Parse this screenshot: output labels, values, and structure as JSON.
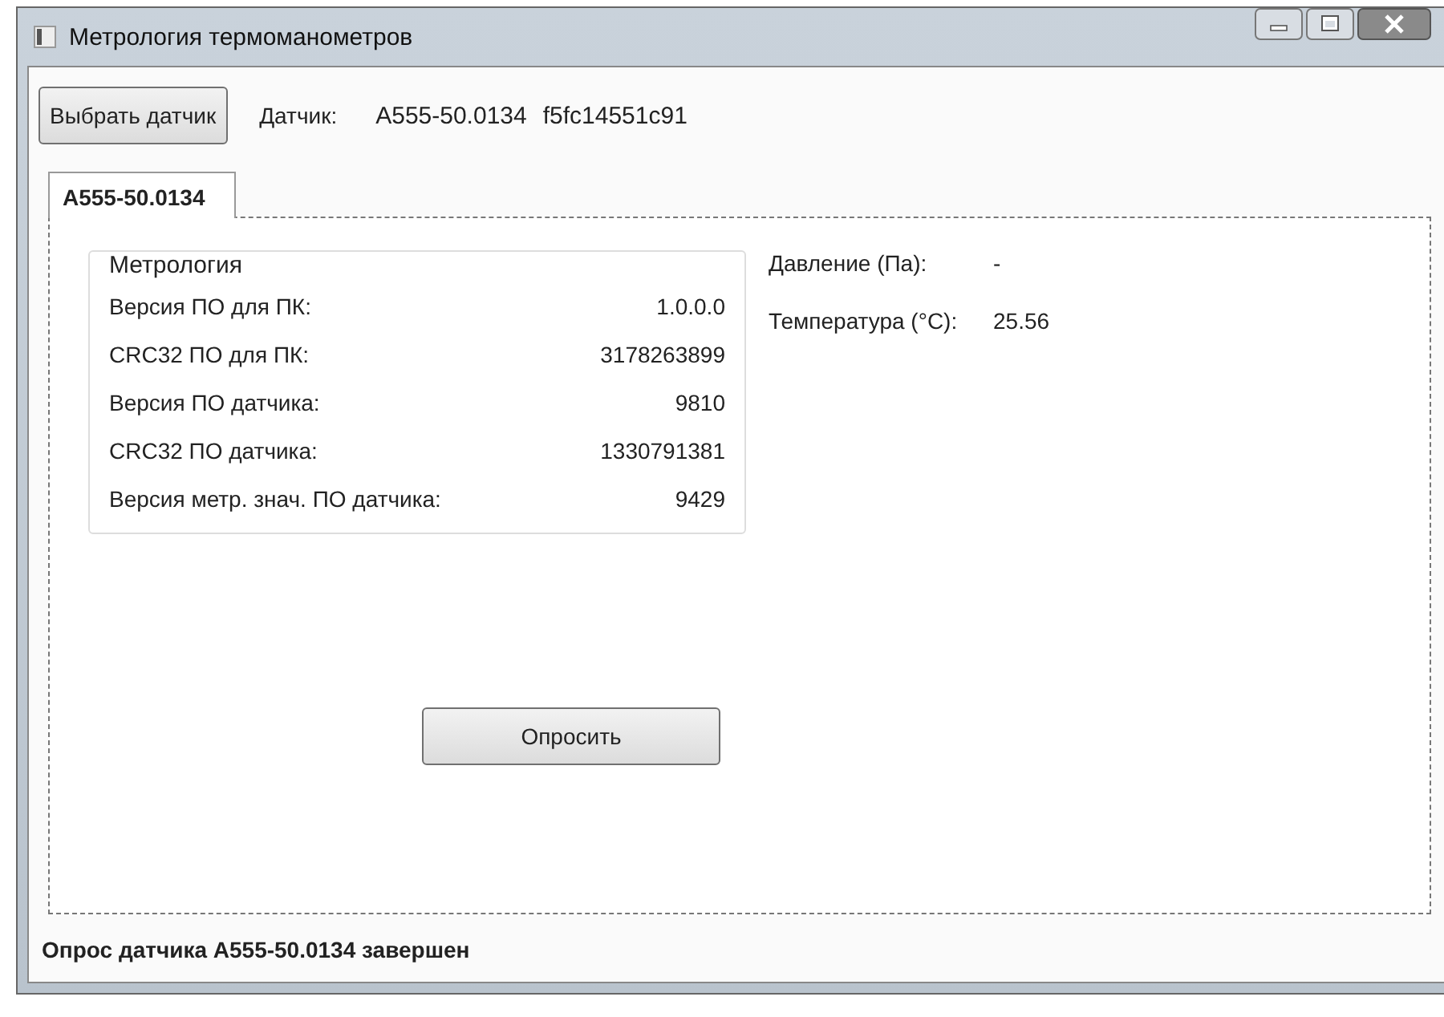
{
  "window": {
    "title": "Метрология термоманометров"
  },
  "toolbar": {
    "select_button": "Выбрать датчик",
    "sensor_label": "Датчик:",
    "sensor_model": "A555-50.0134",
    "sensor_id": "f5fc14551c91"
  },
  "tabs": [
    {
      "label": "A555-50.0134",
      "selected": true
    }
  ],
  "metrology": {
    "title": "Метрология",
    "rows": [
      {
        "label": "Версия ПО для ПК:",
        "value": "1.0.0.0"
      },
      {
        "label": "CRC32 ПО для ПК:",
        "value": "3178263899"
      },
      {
        "label": "Версия ПО датчика:",
        "value": "9810"
      },
      {
        "label": "CRC32 ПО датчика:",
        "value": "1330791381"
      },
      {
        "label": "Версия метр. знач. ПО датчика:",
        "value": "9429"
      }
    ]
  },
  "readings": [
    {
      "label": "Давление (Па):",
      "value": "-"
    },
    {
      "label": "Температура (°C):",
      "value": "25.56"
    }
  ],
  "poll_button": "Опросить",
  "status_bar": "Опрос датчика A555-50.0134 завершен"
}
